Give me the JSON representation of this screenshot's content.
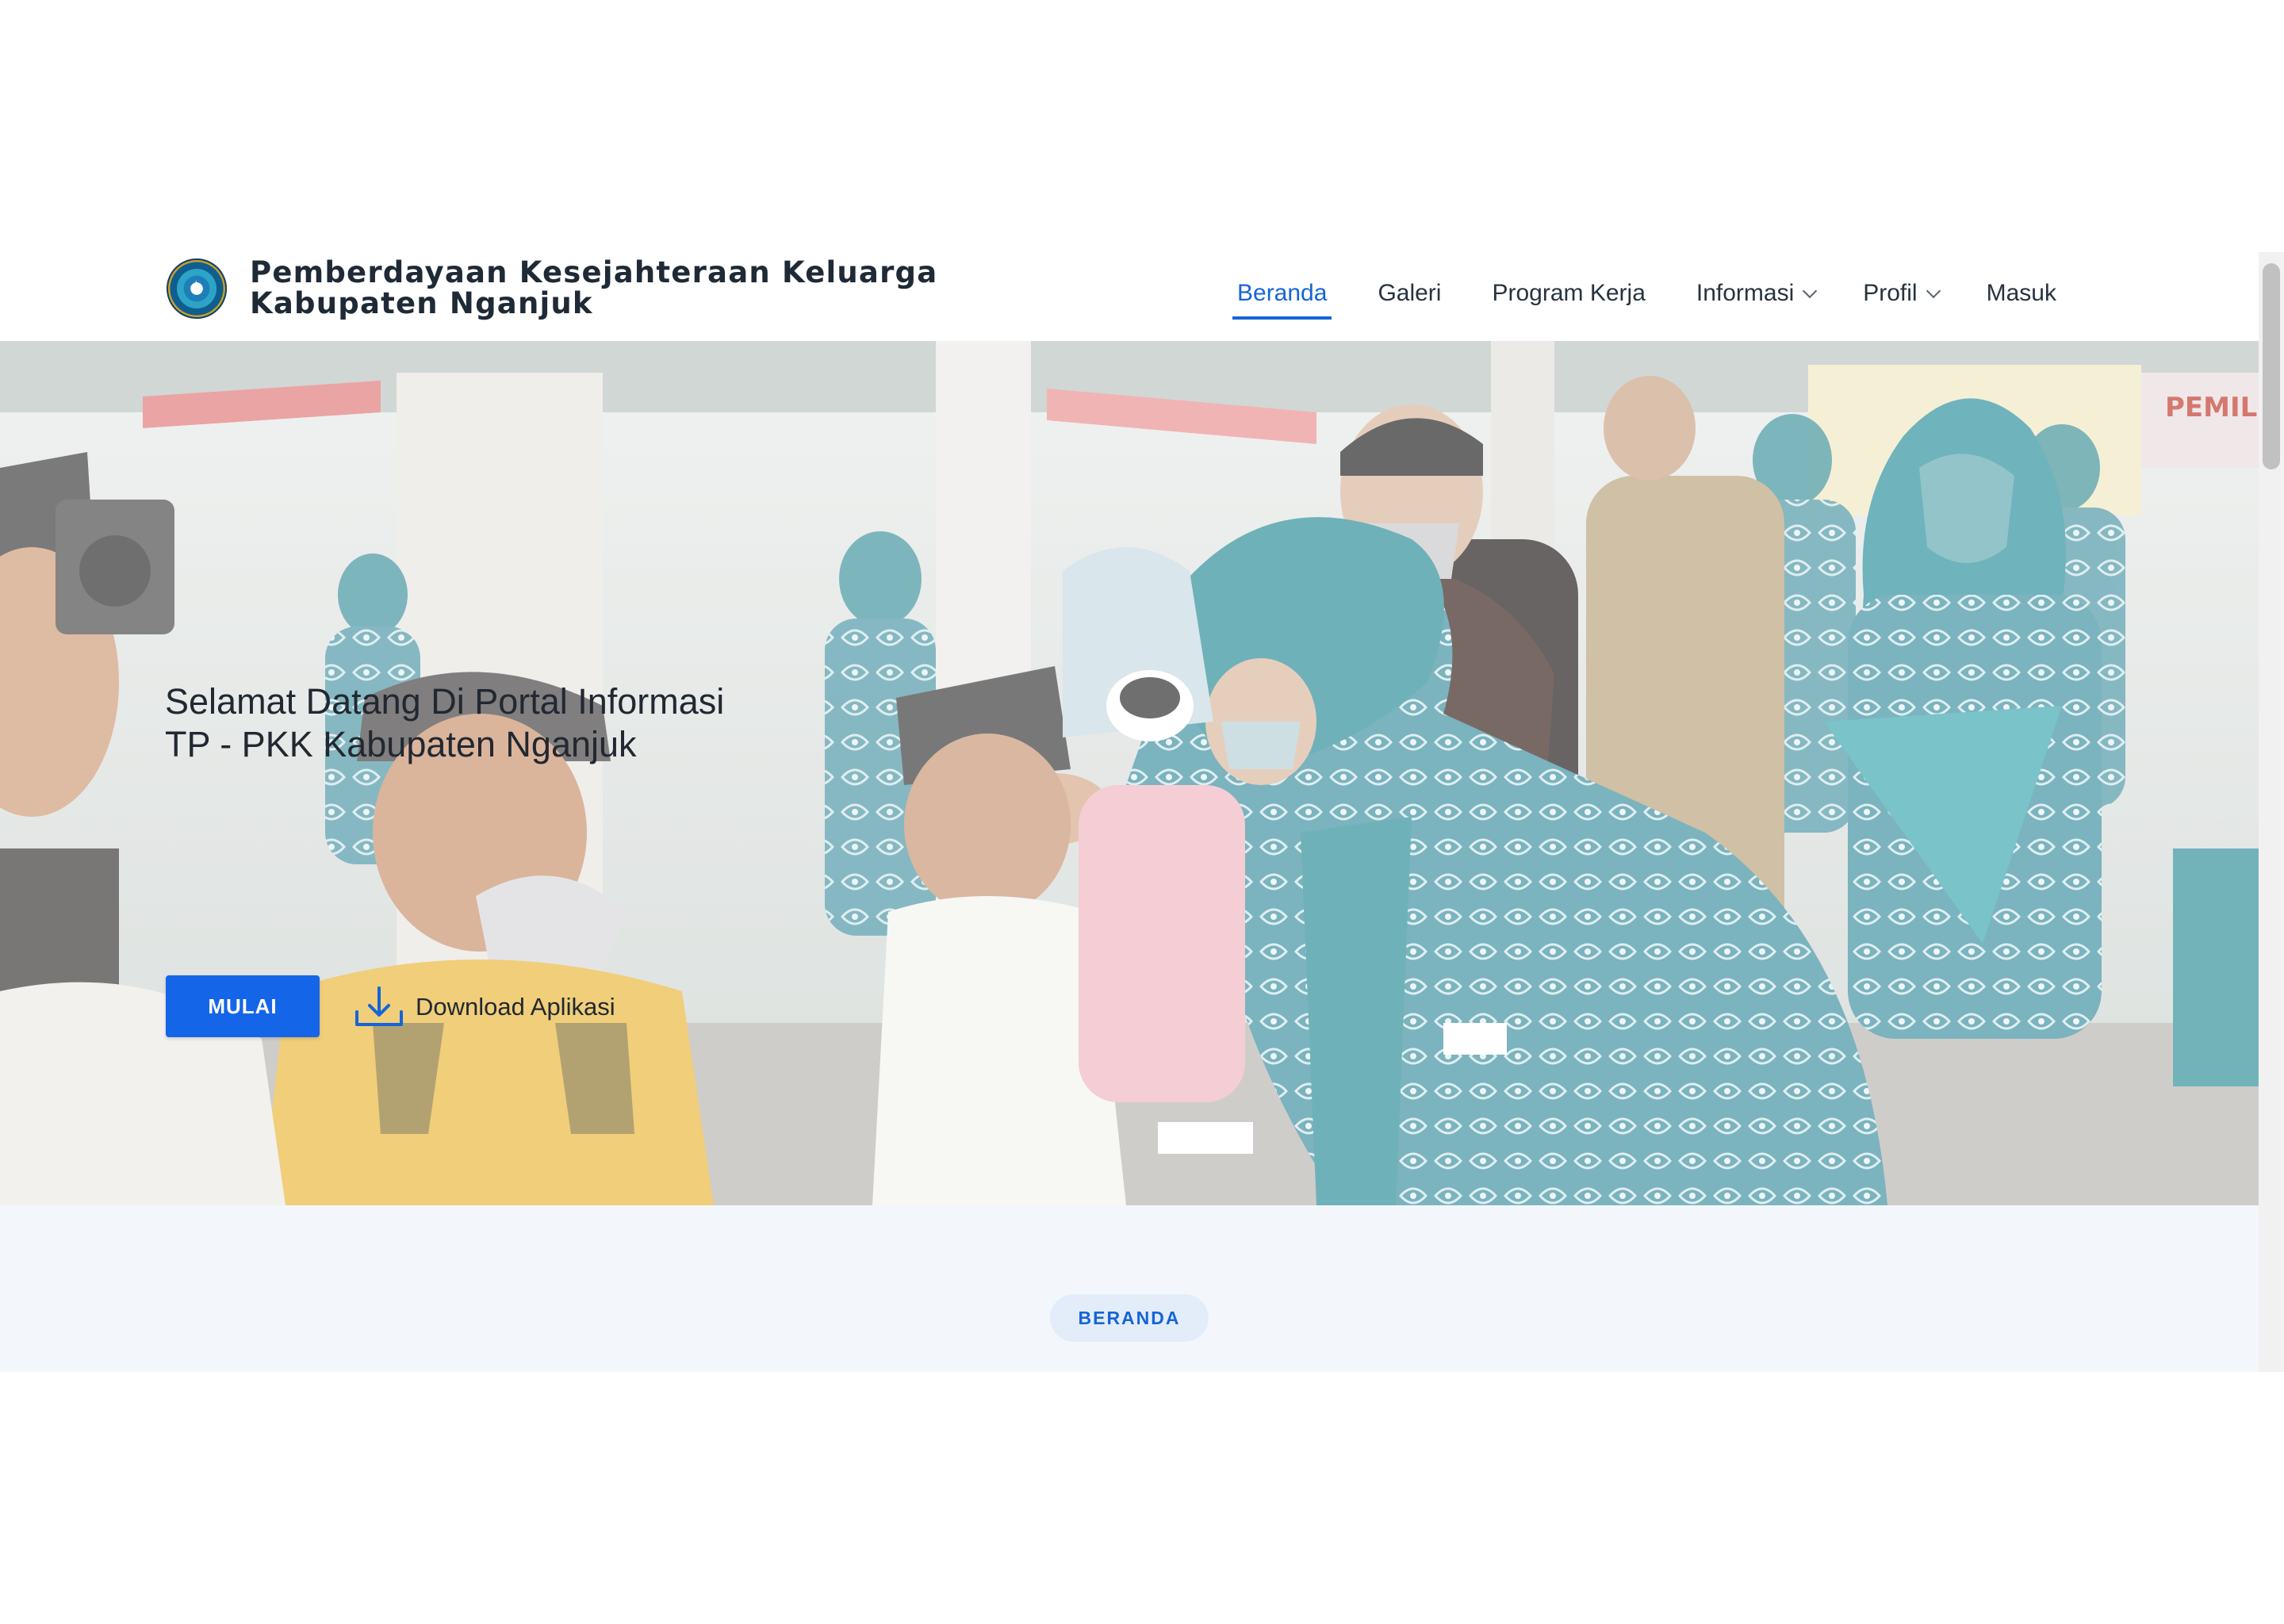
{
  "header": {
    "brand_line1": "Pemberdayaan Kesejahteraan Keluarga",
    "brand_line2": "Kabupaten Nganjuk",
    "logo_icon": "pkk-emblem-icon"
  },
  "nav": {
    "items": [
      {
        "label": "Beranda",
        "active": true
      },
      {
        "label": "Galeri"
      },
      {
        "label": "Program Kerja"
      },
      {
        "label": "Informasi",
        "dropdown": true
      },
      {
        "label": "Profil",
        "dropdown": true
      },
      {
        "label": "Masuk"
      }
    ]
  },
  "hero": {
    "title_line1": "Selamat Datang Di Portal Informasi",
    "title_line2": "TP - PKK Kabupaten Nganjuk",
    "start_button": "MULAI",
    "download_label": "Download Aplikasi",
    "download_icon": "download-icon"
  },
  "section": {
    "badge": "BERANDA"
  },
  "colors": {
    "accent": "#1565e8",
    "nav_active": "#1565d8",
    "section_bg": "#f3f7fb",
    "badge_bg": "#e3edf9"
  }
}
